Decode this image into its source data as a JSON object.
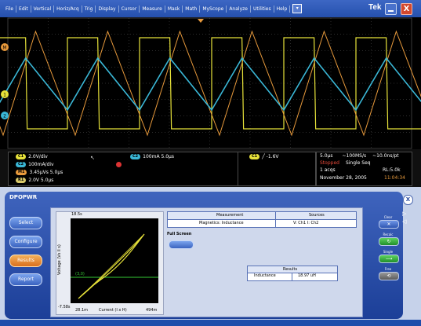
{
  "menu": {
    "items": [
      "File",
      "Edit",
      "Vertical",
      "Horiz/Acq",
      "Trig",
      "Display",
      "Cursor",
      "Measure",
      "Mask",
      "Math",
      "MyScope",
      "Analyze",
      "Utilities",
      "Help"
    ],
    "brand": "Tek",
    "help_arrow": "▾",
    "close_glyph": "X"
  },
  "scope": {
    "markers": {
      "m1": "M",
      "ch1": "1",
      "ch2": "2"
    },
    "trace_colors": {
      "ch1": "#e7e23a",
      "ch2": "#3ab7d6",
      "math": "#e89a3c"
    },
    "grid_color": "#5a5a5a"
  },
  "readout": {
    "left": [
      {
        "tag": "C1",
        "text": "2.0V/div",
        "cls": "ch1"
      },
      {
        "tag": "C2",
        "text": "100mA/div",
        "cls": "ch2"
      },
      {
        "tag": "M1",
        "text": "3.45μVs 5.0μs",
        "cls": "m1"
      },
      {
        "tag": "R1",
        "text": "2.0V     5.0μs",
        "cls": "r1"
      }
    ],
    "mid": [
      {
        "tag": "C2",
        "text": "100mA   5.0μs",
        "cls": "ch2"
      }
    ],
    "trigger": {
      "tag": "C1",
      "text": "╱ -1.6V",
      "cls": "ch1"
    },
    "timebase": {
      "t1": "5.0μs",
      "t2": "~100MS/s",
      "t3": "~10.0ns/pt"
    },
    "status": {
      "state": "Stopped",
      "mode": "Single Seq",
      "acqs": "1 acqs",
      "rl": "RL:5.0k",
      "date": "November 28, 2005",
      "time": "11:04:34"
    }
  },
  "panel": {
    "title": "DPOPWR",
    "nav": [
      "Select",
      "Configure",
      "Results",
      "Report"
    ],
    "active_nav": "Results",
    "plot": {
      "ymax": "18.5s",
      "ymin": "-7.58s",
      "ylabel": "Voltage (Vs ll s)",
      "xmin": "28.1m",
      "xlabel": "Current (I x H)",
      "xmax": "494m",
      "marker": "(3,0)"
    },
    "measurement_table": {
      "header_measurement": "Measurement",
      "header_sources": "Sources",
      "measurement": "Magnetics: Inductance",
      "sources": "V: Ch1  I: Ch2"
    },
    "full_screen": "Full Screen",
    "results": {
      "header": "Results",
      "label": "Inductance",
      "value": "18.97 uH"
    }
  },
  "controls": {
    "clear": "Clear",
    "recalc": "Recalc",
    "single": "Single",
    "free": "Free",
    "panel_close": "X"
  }
}
